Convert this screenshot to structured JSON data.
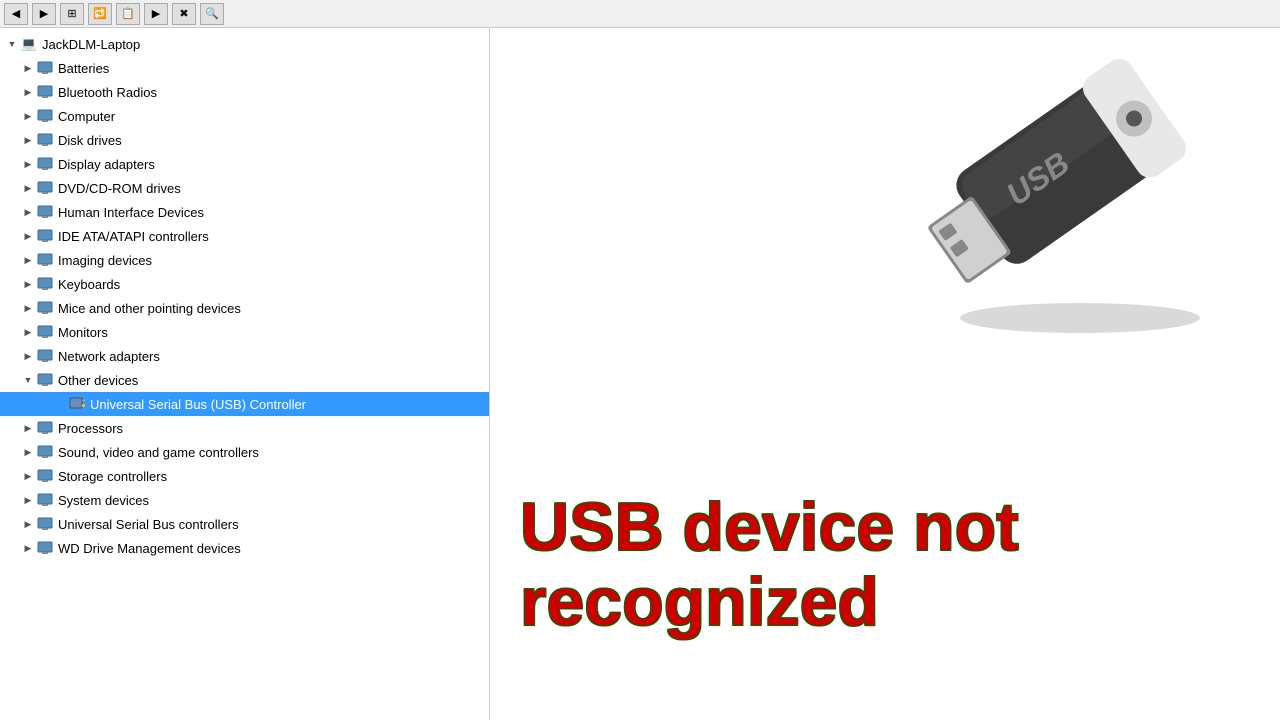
{
  "toolbar": {
    "buttons": [
      "◀",
      "▶",
      "⊞",
      "📋",
      "🖼",
      "▶▶",
      "✖",
      "▶"
    ]
  },
  "tree": {
    "root": {
      "label": "JackDLM-Laptop",
      "icon": "💻",
      "expanded": true
    },
    "items": [
      {
        "id": "batteries",
        "label": "Batteries",
        "icon": "🔋",
        "indent": 1,
        "expanded": false,
        "expander": "▶"
      },
      {
        "id": "bluetooth",
        "label": "Bluetooth Radios",
        "icon": "📡",
        "indent": 1,
        "expanded": false,
        "expander": "▶"
      },
      {
        "id": "computer",
        "label": "Computer",
        "icon": "🖥",
        "indent": 1,
        "expanded": false,
        "expander": "▶"
      },
      {
        "id": "diskdrives",
        "label": "Disk drives",
        "icon": "💾",
        "indent": 1,
        "expanded": false,
        "expander": "▶"
      },
      {
        "id": "displayadapters",
        "label": "Display adapters",
        "icon": "🖥",
        "indent": 1,
        "expanded": false,
        "expander": "▶"
      },
      {
        "id": "dvdrom",
        "label": "DVD/CD-ROM drives",
        "icon": "💿",
        "indent": 1,
        "expanded": false,
        "expander": "▶"
      },
      {
        "id": "hid",
        "label": "Human Interface Devices",
        "icon": "🖱",
        "indent": 1,
        "expanded": false,
        "expander": "▶"
      },
      {
        "id": "ide",
        "label": "IDE ATA/ATAPI controllers",
        "icon": "⚙",
        "indent": 1,
        "expanded": false,
        "expander": "▶"
      },
      {
        "id": "imaging",
        "label": "Imaging devices",
        "icon": "📷",
        "indent": 1,
        "expanded": false,
        "expander": "▶"
      },
      {
        "id": "keyboards",
        "label": "Keyboards",
        "icon": "⌨",
        "indent": 1,
        "expanded": false,
        "expander": "▶"
      },
      {
        "id": "mice",
        "label": "Mice and other pointing devices",
        "icon": "🖱",
        "indent": 1,
        "expanded": false,
        "expander": "▶"
      },
      {
        "id": "monitors",
        "label": "Monitors",
        "icon": "🖥",
        "indent": 1,
        "expanded": false,
        "expander": "▶"
      },
      {
        "id": "network",
        "label": "Network adapters",
        "icon": "🌐",
        "indent": 1,
        "expanded": false,
        "expander": "▶"
      },
      {
        "id": "other",
        "label": "Other devices",
        "icon": "❓",
        "indent": 1,
        "expanded": true,
        "expander": "▼"
      },
      {
        "id": "usb-controller",
        "label": "Universal Serial Bus (USB) Controller",
        "icon": "⚠",
        "indent": 2,
        "expanded": false,
        "expander": "",
        "selected": true,
        "warning": true
      },
      {
        "id": "processors",
        "label": "Processors",
        "icon": "⚙",
        "indent": 1,
        "expanded": false,
        "expander": "▶"
      },
      {
        "id": "sound",
        "label": "Sound, video and game controllers",
        "icon": "🔊",
        "indent": 1,
        "expanded": false,
        "expander": "▶"
      },
      {
        "id": "storage",
        "label": "Storage controllers",
        "icon": "💾",
        "indent": 1,
        "expanded": false,
        "expander": "▶"
      },
      {
        "id": "system",
        "label": "System devices",
        "icon": "⚙",
        "indent": 1,
        "expanded": false,
        "expander": "▶"
      },
      {
        "id": "usb-controllers",
        "label": "Universal Serial Bus controllers",
        "icon": "🔌",
        "indent": 1,
        "expanded": false,
        "expander": "▶"
      },
      {
        "id": "wd",
        "label": "WD Drive Management devices",
        "icon": "🔄",
        "indent": 1,
        "expanded": false,
        "expander": "▶"
      }
    ]
  },
  "error": {
    "line1": "USB device not",
    "line2": "recognized"
  }
}
